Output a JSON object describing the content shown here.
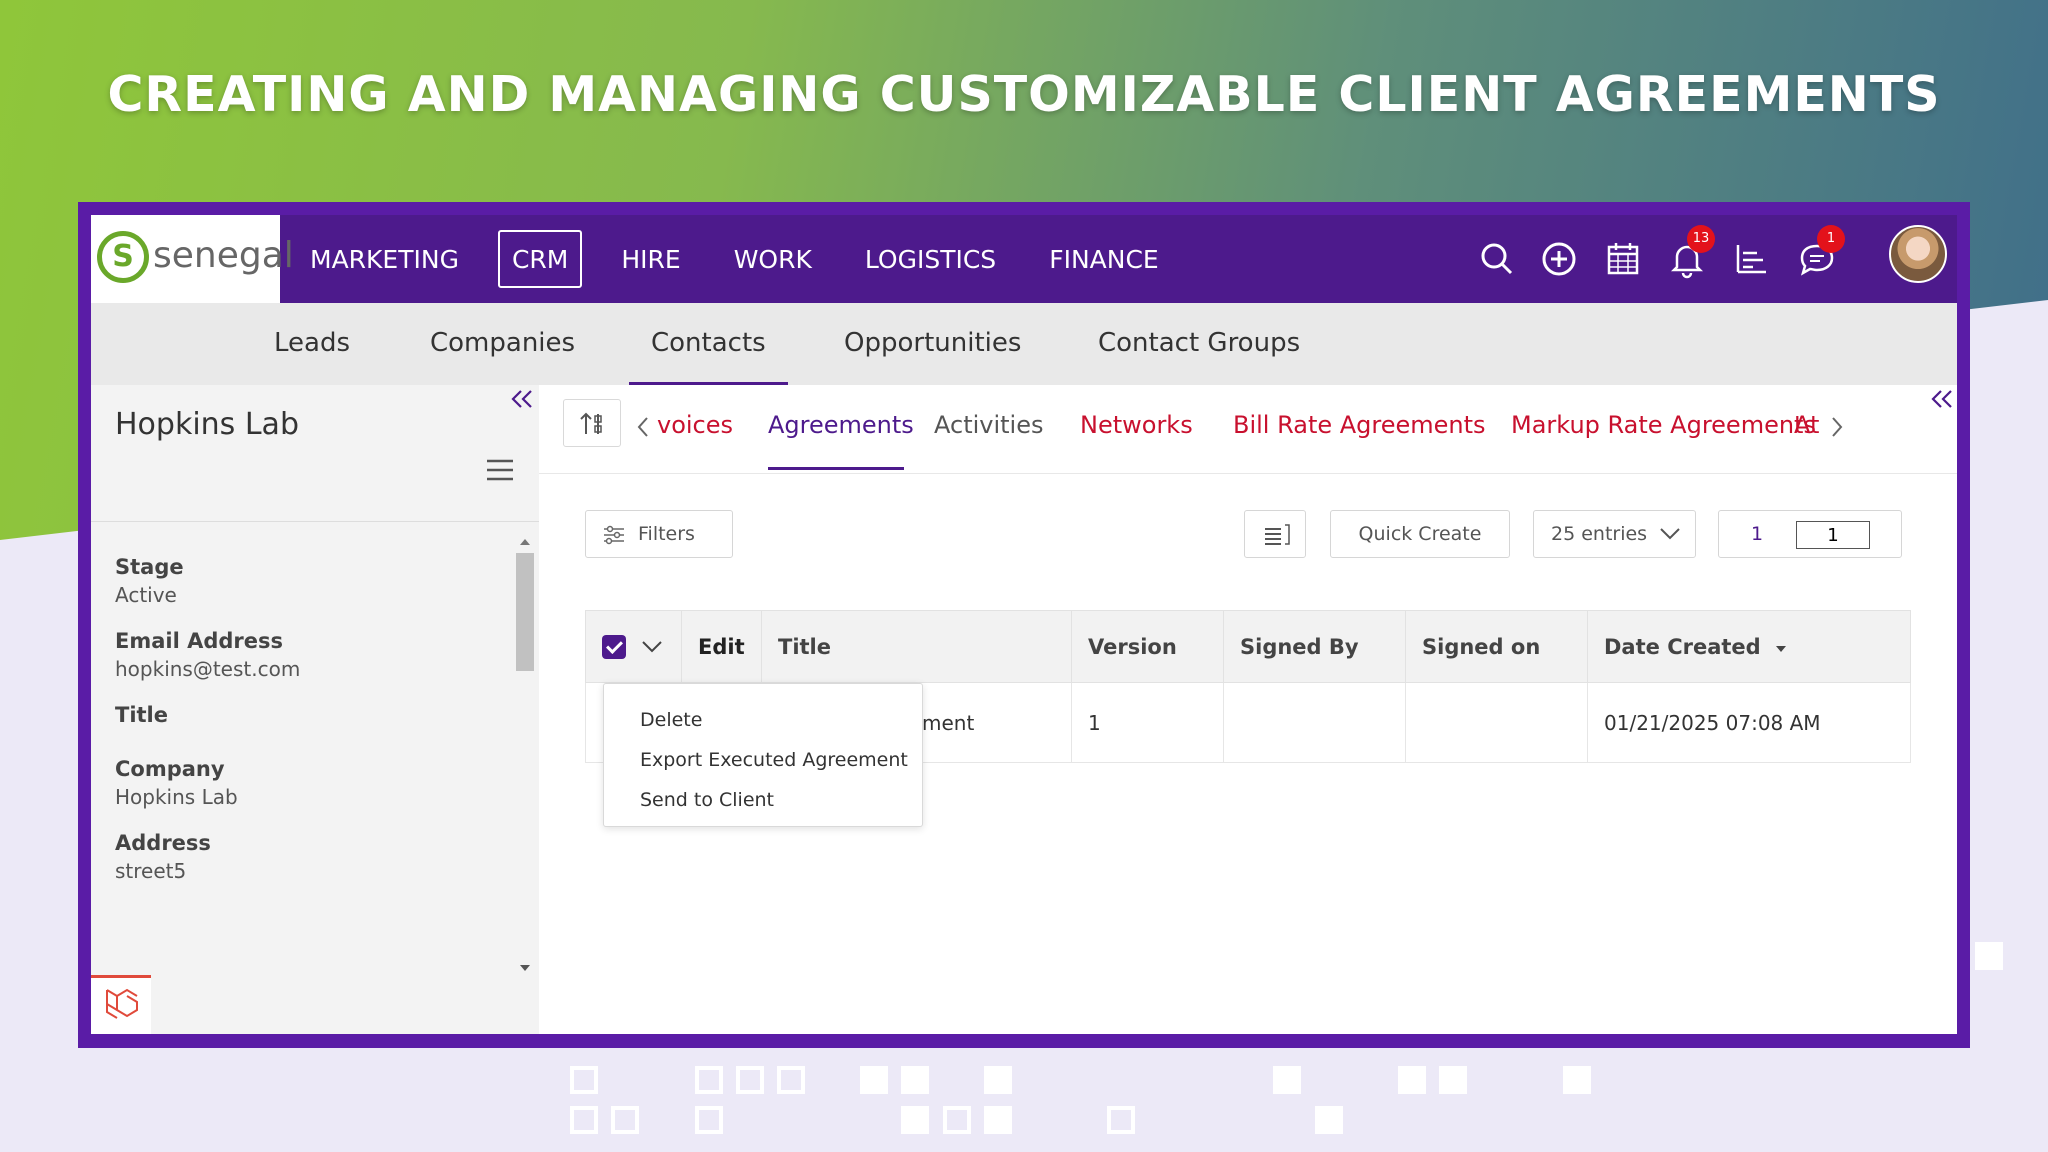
{
  "headline": "CREATING AND MANAGING CUSTOMIZABLE CLIENT AGREEMENTS",
  "brand": {
    "logo_text": "senegal",
    "logo_mark": "S",
    "color_primary": "#4d1a8c",
    "color_accent": "#6aa82a",
    "color_link": "#c8102e"
  },
  "topnav": {
    "items": [
      {
        "label": "MARKETING"
      },
      {
        "label": "CRM",
        "active": true
      },
      {
        "label": "HIRE"
      },
      {
        "label": "WORK"
      },
      {
        "label": "LOGISTICS"
      },
      {
        "label": "FINANCE"
      }
    ],
    "icons": [
      "search-icon",
      "add-circle-icon",
      "calendar-icon",
      "bell-icon",
      "chart-icon",
      "chat-icon",
      "avatar"
    ],
    "notifications_count": "13",
    "messages_count": "1"
  },
  "subnav": {
    "items": [
      {
        "label": "Leads"
      },
      {
        "label": "Companies"
      },
      {
        "label": "Contacts",
        "active": true
      },
      {
        "label": "Opportunities"
      },
      {
        "label": "Contact Groups"
      }
    ]
  },
  "record": {
    "name": "Hopkins Lab",
    "fields": [
      {
        "label": "Stage",
        "value": "Active"
      },
      {
        "label": "Email Address",
        "value": "hopkins@test.com"
      },
      {
        "label": "Title",
        "value": ""
      },
      {
        "label": "Company",
        "value": "Hopkins Lab"
      },
      {
        "label": "Address",
        "value": "street5"
      }
    ]
  },
  "tabs": {
    "items": [
      {
        "label": "voices"
      },
      {
        "label": "Agreements",
        "active": true
      },
      {
        "label": "Activities"
      },
      {
        "label": "Networks"
      },
      {
        "label": "Bill Rate Agreements"
      },
      {
        "label": "Markup Rate Agreements"
      },
      {
        "label": "At"
      }
    ]
  },
  "toolbar": {
    "filters_label": "Filters",
    "quick_create_label": "Quick Create",
    "entries_label": "25 entries",
    "page_current": "1",
    "page_input_value": "1"
  },
  "table": {
    "columns": [
      "Edit",
      "Title",
      "Version",
      "Signed By",
      "Signed on",
      "Date Created"
    ],
    "sort_column": "Date Created",
    "rows": [
      {
        "title": "ment",
        "version": "1",
        "signed_by": "",
        "signed_on": "",
        "date_created": "01/21/2025 07:08 AM"
      }
    ]
  },
  "bulk_menu": {
    "items": [
      "Delete",
      "Export Executed Agreement",
      "Send to Client"
    ]
  }
}
